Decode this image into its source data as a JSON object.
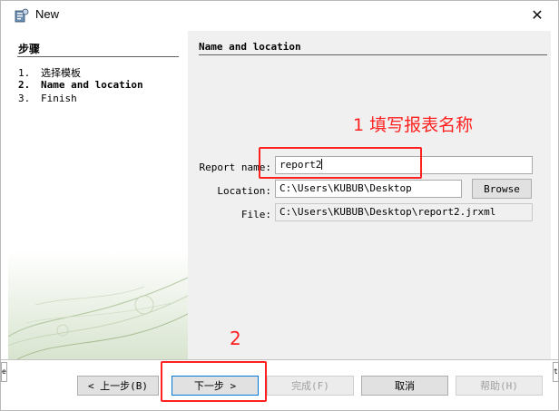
{
  "window": {
    "title": "New",
    "close_glyph": "✕"
  },
  "steps": {
    "header": "步骤",
    "items": [
      {
        "num": "1.",
        "label": "选择模板"
      },
      {
        "num": "2.",
        "label": "Name and location"
      },
      {
        "num": "3.",
        "label": "Finish"
      }
    ]
  },
  "panel": {
    "header": "Name and location",
    "report_name": {
      "label": "Report name:",
      "value": "report2"
    },
    "location": {
      "label": "Location:",
      "value": "C:\\Users\\KUBUB\\Desktop"
    },
    "file": {
      "label": "File:",
      "value": "C:\\Users\\KUBUB\\Desktop\\report2.jrxml"
    },
    "browse_label": "Browse"
  },
  "nav": {
    "back": "< 上一步(B)",
    "next": "下一步 >",
    "finish": "完成(F)",
    "cancel": "取消",
    "help": "帮助(H)"
  },
  "side_strips": {
    "left": "em",
    "right": "t"
  },
  "annotations": {
    "step1": "1 填写报表名称",
    "step2": "2"
  },
  "colors": {
    "annotation": "#ff2020",
    "window_bg": "#f0f0f0"
  }
}
